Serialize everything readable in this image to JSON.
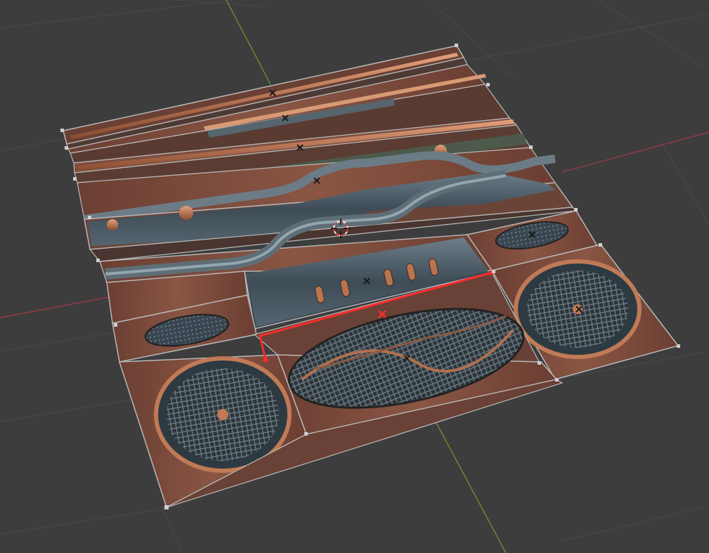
{
  "viewport": {
    "background": "#3d3d3d",
    "grid_color": "#4a4a4a",
    "x_axis_color": "#9a3a45",
    "y_axis_color": "#6e8e2b",
    "selection_color": "#ff2b2b",
    "panel_edge_color": "#b9b9b9",
    "wood_color": "#7a4a3a",
    "metal_color": "#4a5a66",
    "copper_color": "#c07a55",
    "mesh_color": "#2f3940"
  },
  "icons": {
    "cursor": "3d-cursor-icon",
    "origin": "object-origin-icon",
    "active_origin": "active-origin-icon"
  }
}
